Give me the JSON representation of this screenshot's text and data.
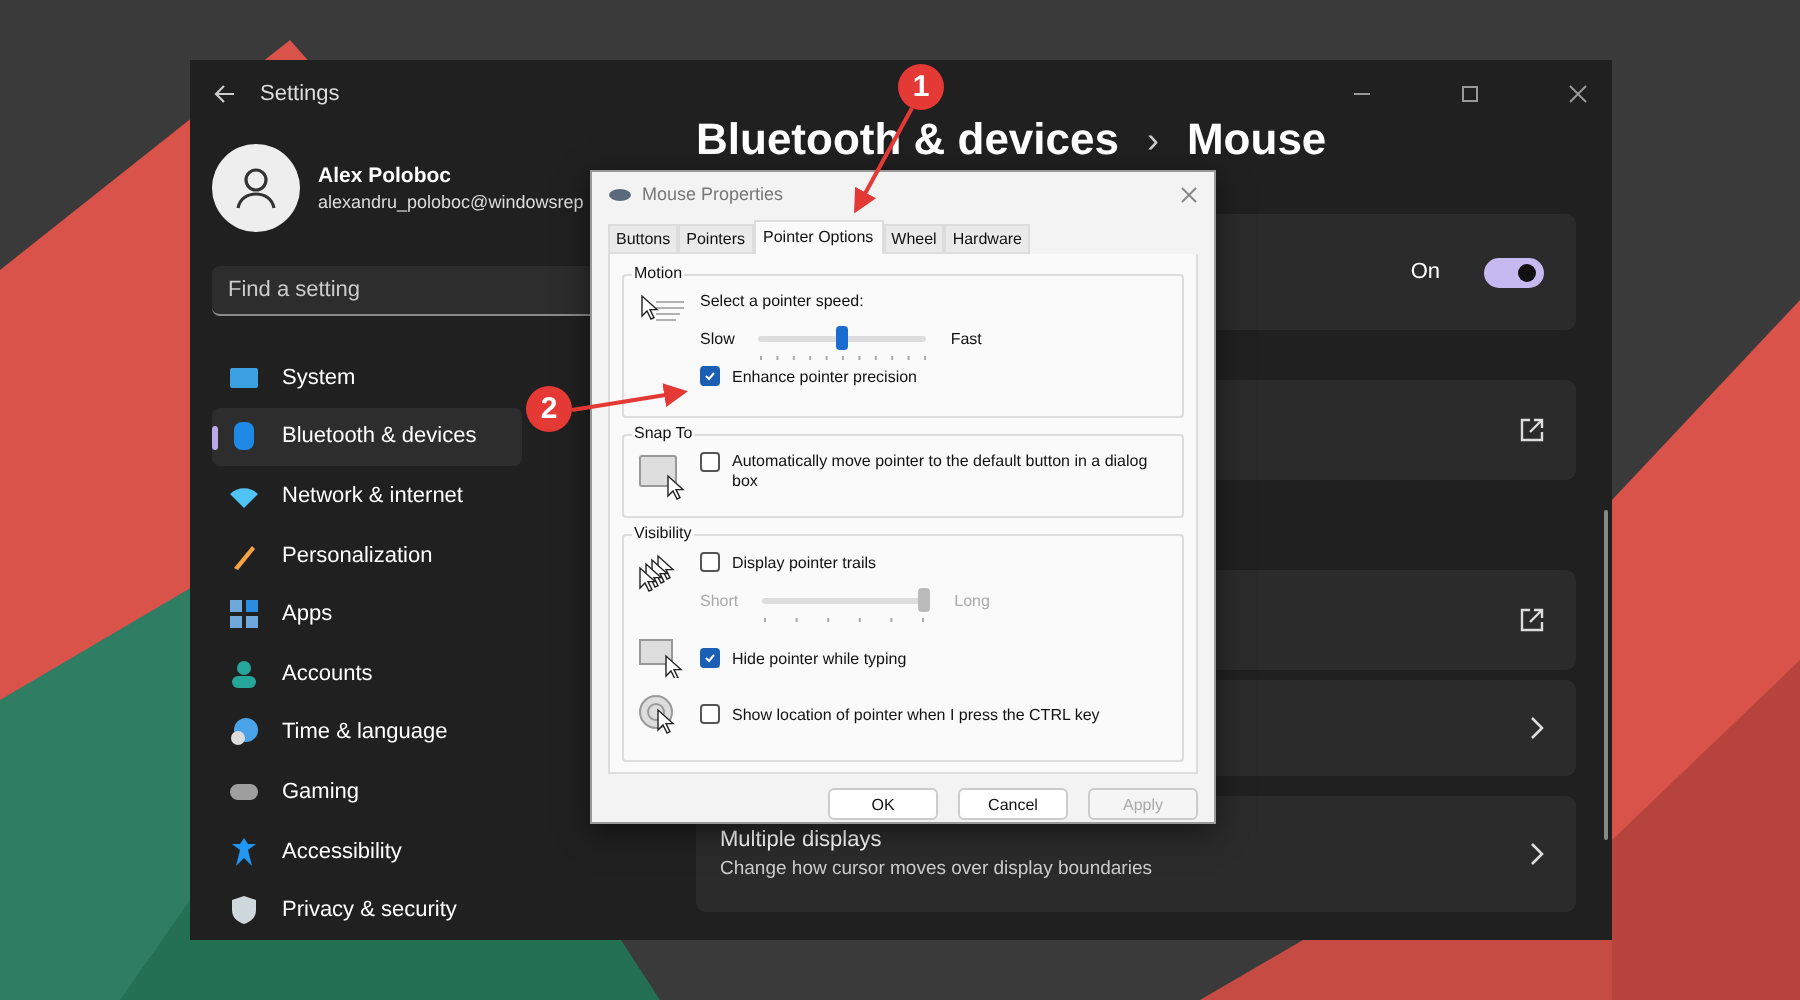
{
  "settings_window": {
    "title": "Settings"
  },
  "profile": {
    "name": "Alex Poloboc",
    "email": "alexandru_poloboc@windowsrep"
  },
  "search": {
    "placeholder": "Find a setting"
  },
  "nav": [
    {
      "label": "System",
      "selected": false
    },
    {
      "label": "Bluetooth & devices",
      "selected": true
    },
    {
      "label": "Network & internet",
      "selected": false
    },
    {
      "label": "Personalization",
      "selected": false
    },
    {
      "label": "Apps",
      "selected": false
    },
    {
      "label": "Accounts",
      "selected": false
    },
    {
      "label": "Time & language",
      "selected": false
    },
    {
      "label": "Gaming",
      "selected": false
    },
    {
      "label": "Accessibility",
      "selected": false
    },
    {
      "label": "Privacy & security",
      "selected": false
    }
  ],
  "header": {
    "section": "Bluetooth & devices",
    "separator": "›",
    "page": "Mouse"
  },
  "cards": [
    {
      "kind": "toggle",
      "value": "On",
      "on": true
    },
    {
      "kind": "link"
    },
    {
      "kind": "link"
    },
    {
      "kind": "chevron"
    },
    {
      "kind": "chevron",
      "title": "Multiple displays",
      "subtitle": "Change how cursor moves over display boundaries"
    }
  ],
  "dialog": {
    "title": "Mouse Properties",
    "tabs": [
      {
        "label": "Buttons",
        "selected": false
      },
      {
        "label": "Pointers",
        "selected": false
      },
      {
        "label": "Pointer Options",
        "selected": true
      },
      {
        "label": "Wheel",
        "selected": false
      },
      {
        "label": "Hardware",
        "selected": false
      }
    ],
    "motion": {
      "heading": "Motion",
      "speed_label": "Select a pointer speed:",
      "slow": "Slow",
      "fast": "Fast",
      "speed": {
        "level": 0.5
      },
      "precision": {
        "label": "Enhance pointer precision",
        "checked": true
      }
    },
    "snap": {
      "heading": "Snap To",
      "option": {
        "label": "Automatically move pointer to the default button in a dialog box",
        "checked": false
      }
    },
    "visibility": {
      "heading": "Visibility",
      "trails": {
        "label": "Display pointer trails",
        "checked": false
      },
      "short": "Short",
      "long": "Long",
      "trail_length": {
        "level": 1,
        "disabled": true
      },
      "hide": {
        "label": "Hide pointer while typing",
        "checked": true
      },
      "locate": {
        "label": "Show location of pointer when I press the CTRL key",
        "checked": false
      }
    },
    "buttons": [
      {
        "label": "OK",
        "disabled": false
      },
      {
        "label": "Cancel",
        "disabled": false
      },
      {
        "label": "Apply",
        "disabled": true
      }
    ]
  },
  "annotations": [
    {
      "number": "1"
    },
    {
      "number": "2"
    }
  ]
}
